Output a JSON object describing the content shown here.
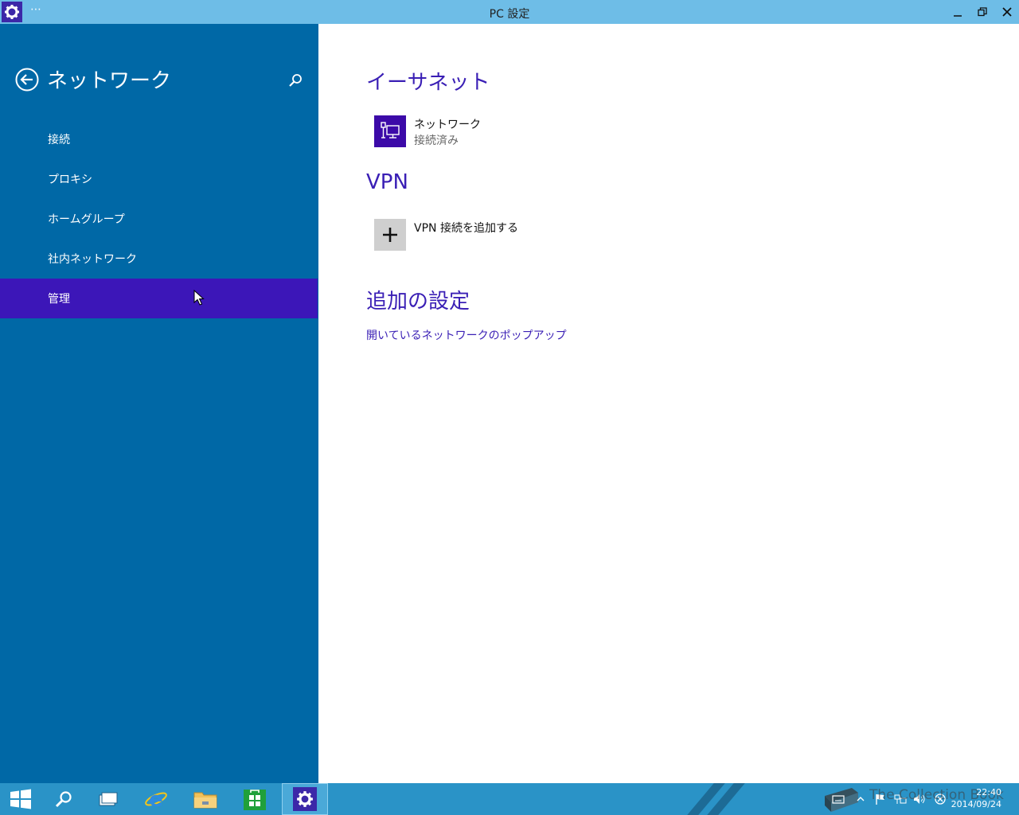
{
  "window": {
    "title": "PC 設定",
    "menu_label": "⋯"
  },
  "sidebar": {
    "title": "ネットワーク",
    "items": [
      {
        "label": "接続"
      },
      {
        "label": "プロキシ"
      },
      {
        "label": "ホームグループ"
      },
      {
        "label": "社内ネットワーク"
      },
      {
        "label": "管理",
        "selected": true
      }
    ]
  },
  "main": {
    "ethernet": {
      "heading": "イーサネット",
      "network_name": "ネットワーク",
      "network_status": "接続済み"
    },
    "vpn": {
      "heading": "VPN",
      "add_label": "VPN 接続を追加する"
    },
    "additional": {
      "heading": "追加の設定",
      "link": "開いているネットワークのポップアップ"
    }
  },
  "taskbar": {
    "clock_time": "22:40",
    "clock_date": "2014/09/24",
    "watermark": "The Collection Book"
  },
  "colors": {
    "sidebar": "#0068a6",
    "selected": "#3c16b8",
    "accent": "#3a1fb5",
    "titlebar": "#6ebde7",
    "taskbar": "#2a93c7"
  }
}
